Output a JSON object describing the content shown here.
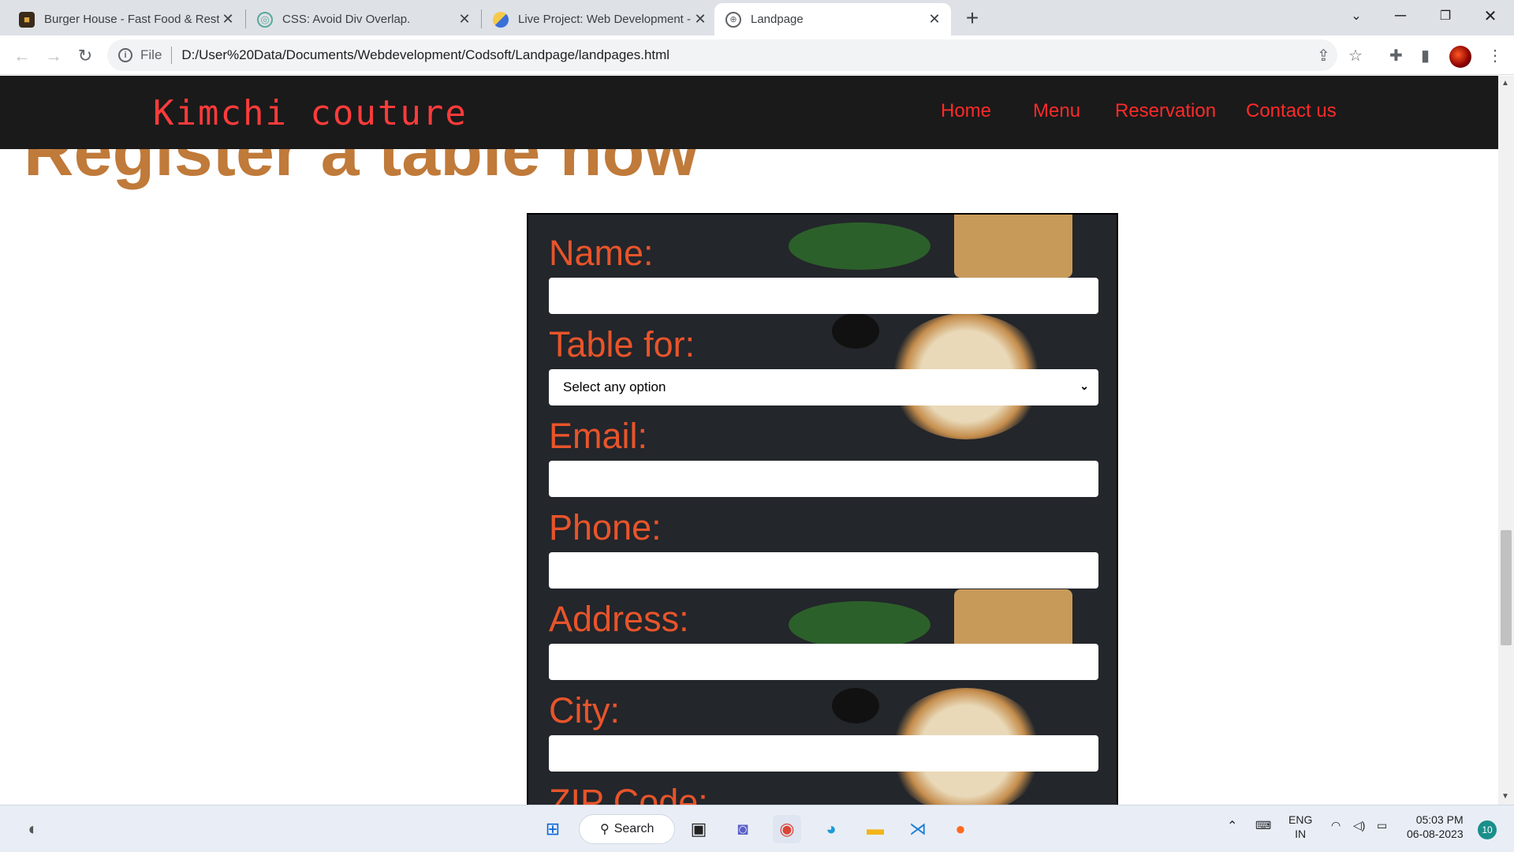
{
  "browser": {
    "tabs": [
      {
        "title": "Burger House - Fast Food & Rest",
        "icon": "burger-favicon"
      },
      {
        "title": "CSS: Avoid Div Overlap.",
        "icon": "chatgpt-favicon"
      },
      {
        "title": "Live Project: Web Development -",
        "icon": "python-favicon"
      },
      {
        "title": "Landpage",
        "icon": "globe-favicon"
      }
    ],
    "address": {
      "scheme_label": "File",
      "url": "D:/User%20Data/Documents/Webdevelopment/Codsoft/Landpage/landpages.html"
    }
  },
  "site": {
    "logo": "Kimchi couture",
    "nav": [
      "Home",
      "Menu",
      "Reservation",
      "Contact us"
    ],
    "heading": "Register a table now",
    "colors": {
      "header_bg": "#1a1a1a",
      "logo": "#ff3b3b",
      "nav": "#ff2a2a",
      "heading": "#c07a3a",
      "label": "#e8542a"
    }
  },
  "form": {
    "fields": [
      {
        "label": "Name:",
        "type": "text",
        "value": ""
      },
      {
        "label": "Table for:",
        "type": "select",
        "value": "Select any option"
      },
      {
        "label": "Email:",
        "type": "text",
        "value": ""
      },
      {
        "label": "Phone:",
        "type": "text",
        "value": ""
      },
      {
        "label": "Address:",
        "type": "text",
        "value": ""
      },
      {
        "label": "City:",
        "type": "text",
        "value": ""
      },
      {
        "label": "ZIP Code:",
        "type": "text",
        "value": ""
      }
    ]
  },
  "taskbar": {
    "search_label": "Search",
    "language": "ENG",
    "region": "IN",
    "time": "05:03 PM",
    "date": "06-08-2023",
    "notification_count": "10"
  }
}
